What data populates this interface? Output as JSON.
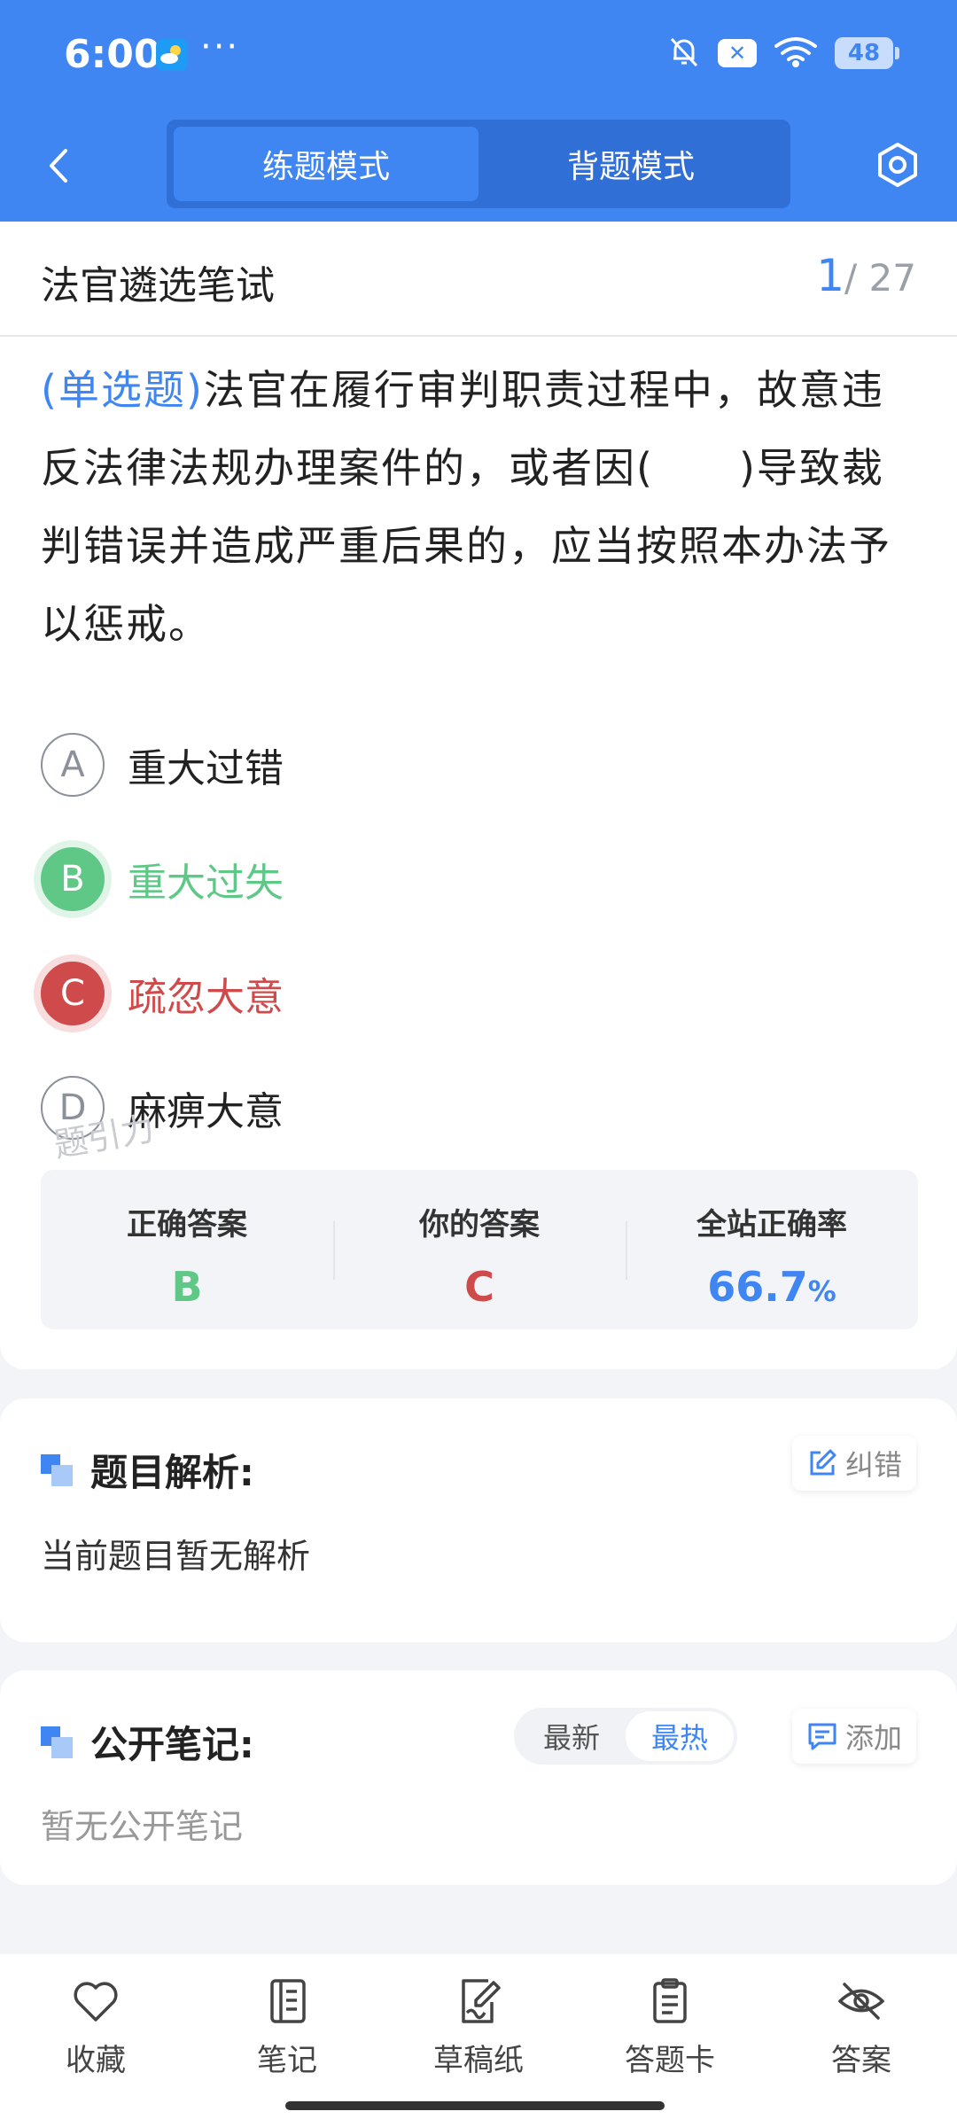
{
  "status_bar": {
    "time": "6:00",
    "dots": "···",
    "battery": "48"
  },
  "nav": {
    "tabs": [
      {
        "label": "练题模式",
        "active": true
      },
      {
        "label": "背题模式",
        "active": false
      }
    ]
  },
  "exam": {
    "title": "法官遴选笔试",
    "current": "1",
    "total": "/ 27"
  },
  "question": {
    "type": "(单选题)",
    "text": "法官在履行审判职责过程中，故意违反法律法规办理案件的，或者因(　　)导致裁判错误并造成严重后果的，应当按照本办法予以惩戒。"
  },
  "options": [
    {
      "letter": "A",
      "text": "重大过错",
      "state": "normal"
    },
    {
      "letter": "B",
      "text": "重大过失",
      "state": "correct"
    },
    {
      "letter": "C",
      "text": "疏忽大意",
      "state": "wrong"
    },
    {
      "letter": "D",
      "text": "麻痹大意",
      "state": "normal"
    }
  ],
  "watermark": "题引力",
  "stats": {
    "correct_label": "正确答案",
    "correct_value": "B",
    "yours_label": "你的答案",
    "yours_value": "C",
    "rate_label": "全站正确率",
    "rate_value": "66.7",
    "rate_unit": "%"
  },
  "analysis": {
    "title": "题目解析:",
    "report_label": "纠错",
    "body": "当前题目暂无解析"
  },
  "notes": {
    "title": "公开笔记:",
    "sort_latest": "最新",
    "sort_hot": "最热",
    "add_label": "添加",
    "body": "暂无公开笔记"
  },
  "toolbar": {
    "favorite": "收藏",
    "notes": "笔记",
    "draft": "草稿纸",
    "answer_card": "答题卡",
    "answer": "答案"
  },
  "colors": {
    "primary": "#3f86f2",
    "correct": "#5fc886",
    "wrong": "#cf4b4b"
  }
}
